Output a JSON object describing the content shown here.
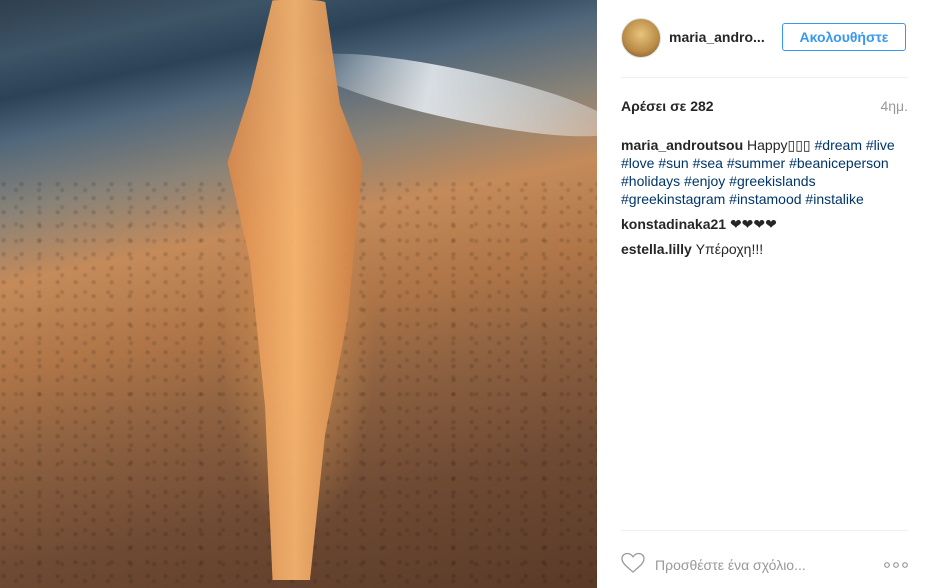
{
  "post": {
    "photo_icon": "photo",
    "header": {
      "username": "maria_andro...",
      "follow_label": "Ακολουθήστε"
    },
    "likes_text": "Αρέσει σε 282",
    "time_text": "4ημ.",
    "caption": {
      "author": "maria_androutsou",
      "text": "Happy▯▯▯",
      "tags_line1": "#dream #live",
      "tags_line2": "#love #sun #sea #summer #beaniceperson",
      "tags_line3": "#holidays #enjoy #greekislands",
      "tags_line4": "#greekinstagram #instamood #instalike"
    },
    "comments": [
      {
        "author": "konstadinaka21",
        "text": "❤❤❤❤"
      },
      {
        "author": "estella.lilly",
        "text": "Υπέροχη!!!"
      }
    ],
    "footer": {
      "heart_icon": "heart-outline-icon",
      "add_comment_placeholder": "Προσθέστε ένα σχόλιο...",
      "more_label": "○○○"
    }
  },
  "colors": {
    "link": "#003569",
    "accent": "#3897f0",
    "muted": "#999999"
  }
}
